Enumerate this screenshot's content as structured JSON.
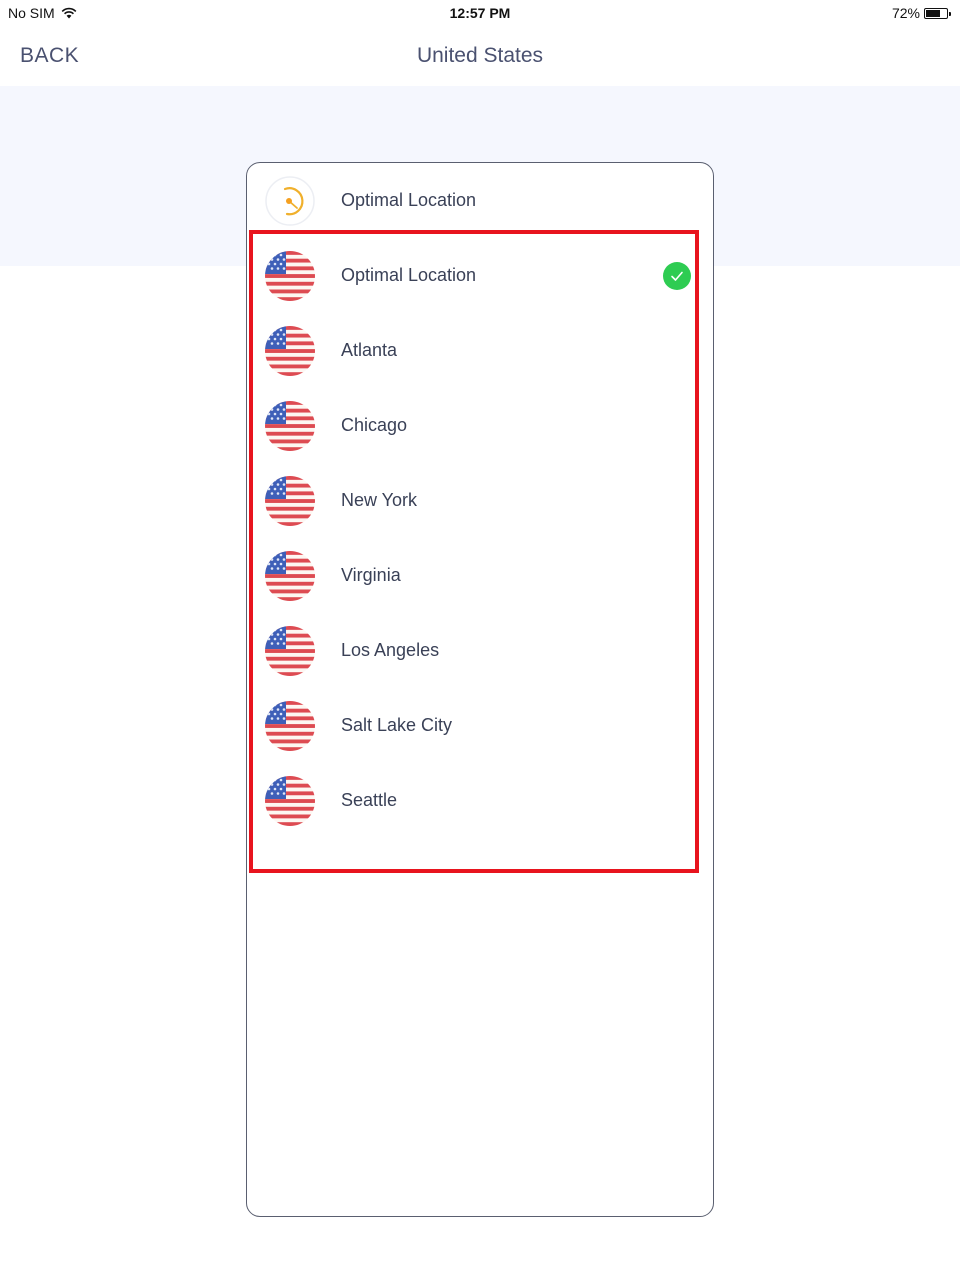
{
  "status_bar": {
    "carrier": "No SIM",
    "wifi_icon": "wifi-icon",
    "time": "12:57 PM",
    "battery_percent": "72%",
    "battery_level": 0.72
  },
  "nav": {
    "back_label": "BACK",
    "title": "United States"
  },
  "optimal_header": {
    "label": "Optimal Location",
    "icon": "speedometer-icon"
  },
  "locations": [
    {
      "label": "Optimal Location",
      "icon": "us-flag-icon",
      "selected": true
    },
    {
      "label": "Atlanta",
      "icon": "us-flag-icon",
      "selected": false
    },
    {
      "label": "Chicago",
      "icon": "us-flag-icon",
      "selected": false
    },
    {
      "label": "New York",
      "icon": "us-flag-icon",
      "selected": false
    },
    {
      "label": "Virginia",
      "icon": "us-flag-icon",
      "selected": false
    },
    {
      "label": "Los Angeles",
      "icon": "us-flag-icon",
      "selected": false
    },
    {
      "label": "Salt Lake City",
      "icon": "us-flag-icon",
      "selected": false
    },
    {
      "label": "Seattle",
      "icon": "us-flag-icon",
      "selected": false
    }
  ],
  "colors": {
    "accent_check": "#2ecc52",
    "highlight_box": "#e8141e",
    "header_band": "#f5f7fe",
    "text": "#3a4157"
  }
}
